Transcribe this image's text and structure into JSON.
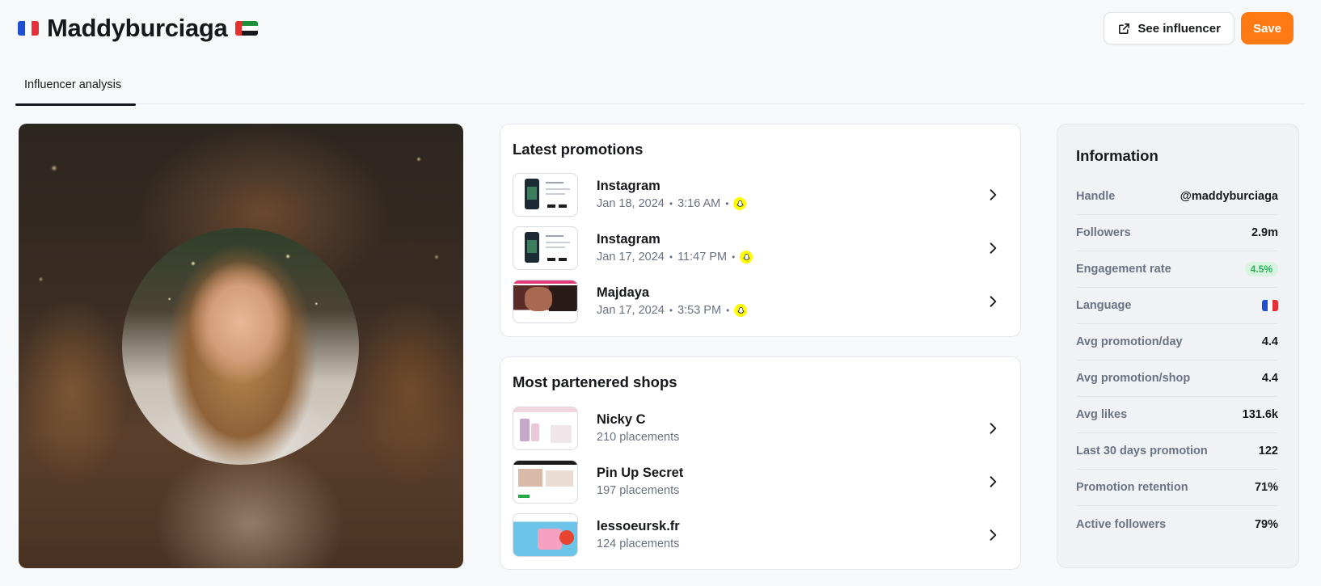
{
  "header": {
    "title": "Maddyburciaga",
    "see_influencer_label": "See influencer",
    "save_label": "Save"
  },
  "tabs": [
    {
      "label": "Influencer analysis",
      "active": true
    }
  ],
  "latest_promotions": {
    "title": "Latest promotions",
    "items": [
      {
        "title": "Instagram",
        "date": "Jan 18, 2024",
        "time": "3:16 AM",
        "platform_icon": "snapchat-icon"
      },
      {
        "title": "Instagram",
        "date": "Jan 17, 2024",
        "time": "11:47 PM",
        "platform_icon": "snapchat-icon"
      },
      {
        "title": "Majdaya",
        "date": "Jan 17, 2024",
        "time": "3:53 PM",
        "platform_icon": "snapchat-icon"
      }
    ]
  },
  "partnered_shops": {
    "title": "Most partenered shops",
    "items": [
      {
        "title": "Nicky C",
        "sub": "210 placements"
      },
      {
        "title": "Pin Up Secret",
        "sub": "197 placements"
      },
      {
        "title": "lessoeursk.fr",
        "sub": "124 placements"
      }
    ]
  },
  "information": {
    "title": "Information",
    "rows": [
      {
        "label": "Handle",
        "value": "@maddyburciaga"
      },
      {
        "label": "Followers",
        "value": "2.9m"
      },
      {
        "label": "Engagement rate",
        "value": "4.5%"
      },
      {
        "label": "Language",
        "value_icon": "france-flag-icon"
      },
      {
        "label": "Avg promotion/day",
        "value": "4.4"
      },
      {
        "label": "Avg promotion/shop",
        "value": "4.4"
      },
      {
        "label": "Avg likes",
        "value": "131.6k"
      },
      {
        "label": "Last 30 days promotion",
        "value": "122"
      },
      {
        "label": "Promotion retention",
        "value": "71%"
      },
      {
        "label": "Active followers",
        "value": "79%"
      }
    ]
  },
  "colors": {
    "accent": "#ff7a12",
    "engagement_pill_text": "#2bb05a",
    "engagement_pill_bg": "#d6f4df",
    "snapchat": "#fffc00"
  }
}
